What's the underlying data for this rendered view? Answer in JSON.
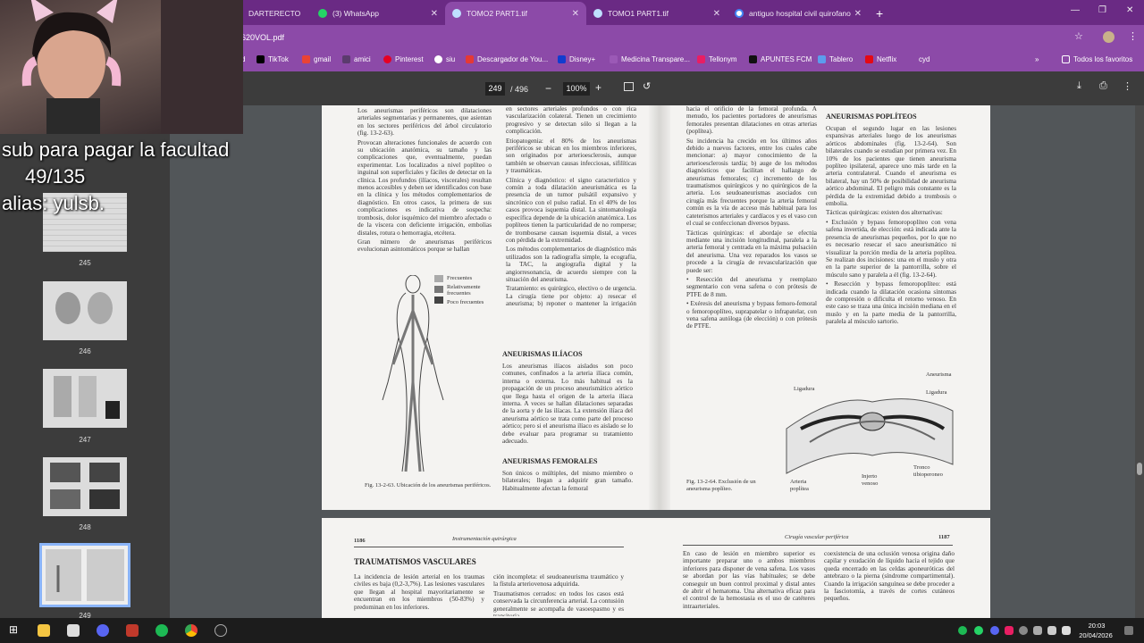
{
  "browser": {
    "tabs": [
      {
        "label": "DARTERECTO",
        "icon": "page-icon",
        "active": false
      },
      {
        "label": "(3) WhatsApp",
        "icon": "whatsapp-icon",
        "active": false
      },
      {
        "label": "TOMO2 PART1.tif",
        "icon": "page-icon",
        "active": true
      },
      {
        "label": "TOMO1 PART1.tif",
        "icon": "page-icon",
        "active": false
      },
      {
        "label": "antiguo hospital civil quirofano",
        "icon": "google-icon",
        "active": false
      }
    ],
    "new_tab": "+",
    "url": "620VOL.pdf",
    "bookmarks": [
      "d",
      "TikTok",
      "gmail",
      "amici",
      "Pinterest",
      "siu",
      "Descargador de You...",
      "Disney+",
      "Medicina Transpare...",
      "Tellonym",
      "APUNTES FCM",
      "Tablero",
      "Netflix",
      "cyd"
    ],
    "all_bookmarks": "Todos los favoritos"
  },
  "pdf": {
    "current_page": "249",
    "total_pages": "/ 496",
    "zoom": "100%",
    "thumbnails": [
      "245",
      "246",
      "247",
      "248",
      "249"
    ]
  },
  "overlay": {
    "line1": "sub para pagar la facultad",
    "line2": "49/135",
    "line3": "alias: yulsb."
  },
  "page_left": {
    "col1": [
      "Los aneurismas periféricos son dilataciones arteriales segmentarias y permanentes, que asientan en los sectores periféricos del árbol circulatorio (fig. 13-2-63).",
      "Provocan alteraciones funcionales de acuerdo con su ubicación anatómica, su tamaño y las complicaciones que, eventualmente, puedan experimentar. Los localizados a nivel poplíteo o inguinal son superficiales y fáciles de detectar en la clínica. Los profundos (ilíacos, viscerales) resultan menos accesibles y deben ser identificados con base en la clínica y los métodos complementarios de diagnóstico. En otros casos, la primera de sus complicaciones es indicativa de sospecha: trombosis, dolor isquémico del miembro afectado o de la víscera con deficiente irrigación, embolias distales, rotura o hemorragia, etcétera.",
      "Gran número de aneurismas periféricos evolucionan asintomáticos porque se hallan"
    ],
    "col2": [
      "en sectores arteriales profundos o con rica vascularización colateral. Tienen un crecimiento progresivo y se detectan sólo si llegan a la complicación.",
      "Etiopatogenia: el 80% de los aneurismas periféricos se ubican en los miembros inferiores, son originados por arterioesclerosis, aunque también se observan causas infecciosas, sifilíticas y traumáticas.",
      "Clínica y diagnóstico: el signo característico y común a toda dilatación aneurismática es la presencia de un tumor pulsátil expansivo y sincrónico con el pulso radial. En el 40% de los casos provoca isquemia distal. La sintomatología específica depende de la ubicación anatómica. Los poplíteos tienen la particularidad de no romperse; de trombosarse causan isquemia distal, a veces con pérdida de la extremidad.",
      "Los métodos complementarios de diagnóstico más utilizados son la radiografía simple, la ecografía, la TAC, la angiografía digital y la angiorresonancia, de acuerdo siempre con la situación del aneurisma.",
      "Tratamiento: es quirúrgico, electivo o de urgencia. La cirugía tiene por objeto: a) resecar el aneurisma; b) reponer o mantener la irrigación arterial; c) resolver las complicaciones isquémicas distales."
    ],
    "heading_iliacos": "ANEURISMAS ILÍACOS",
    "col2b": [
      "Los aneurismas ilíacos aislados son poco comunes, confinados a la arteria ilíaca común, interna o externa. Lo más habitual es la propagación de un proceso aneurismático aórtico que llega hasta el origen de la arteria ilíaca interna. A veces se hallan dilataciones separadas de la aorta y de las ilíacas. La extensión ilíaca del aneurisma aórtico se trata como parte del proceso aórtico; pero si el aneurisma ilíaco es aislado se lo debe evaluar para programar su tratamiento adecuado."
    ],
    "heading_femorales": "ANEURISMAS FEMORALES",
    "col2c": [
      "Son únicos o múltiples, del mismo miembro o bilaterales; llegan a adquirir gran tamaño. Habitualmente afectan la femoral"
    ],
    "legend": [
      "Frecuentes",
      "Relativamente frecuentes",
      "Poco frecuentes"
    ],
    "figure_caption": "Fig. 13-2-63. Ubicación de los aneurismas periféricos."
  },
  "page_right": {
    "col1": [
      "hacia el orificio de la femoral profunda. A menudo, los pacientes portadores de aneurismas femorales presentan dilataciones en otras arterias (poplítea).",
      "Su incidencia ha crecido en los últimos años debido a nuevos factores, entre los cuales cabe mencionar: a) mayor conocimiento de la arterioesclerosis tardía; b) auge de los métodos diagnósticos que facilitan el hallazgo de aneurismas femorales; c) incremento de los traumatismos quirúrgicos y no quirúrgicos de la arteria. Los seudoaneurismas asociados con cirugía más frecuentes porque la arteria femoral común es la vía de acceso más habitual para los cateterismos arteriales y cardíacos y es el vaso con el cual se confeccionan diversos bypass.",
      "Tácticas quirúrgicas: el abordaje se efectúa mediante una incisión longitudinal, paralela a la arteria femoral y centrada en la máxima pulsación del aneurisma. Una vez reparados los vasos se procede a la cirugía de revascularización que puede ser:",
      "• Resección del aneurisma y reemplazo segmentario con vena safena o con prótesis de PTFE de 8 mm.",
      "• Exéresis del aneurisma y bypass femoro-femoral o femoropoplíteo, suprapatelar o infrapatelar, con vena safena autóloga (de elección) o con prótesis de PTFE."
    ],
    "heading_popliteos": "ANEURISMAS POPLÍTEOS",
    "col2": [
      "Ocupan el segundo lugar en las lesiones expansivas arteriales luego de los aneurismas aórticos abdominales (fig. 13-2-64). Son bilaterales cuando se estudian por primera vez. En 10% de los pacientes que tienen aneurisma poplíteo ipsilateral, aparece uno más tarde en la arteria contralateral. Cuando el aneurisma es bilateral, hay un 50% de posibilidad de aneurisma aórtico abdominal. El peligro más constante es la pérdida de la extremidad debido a trombosis o embolia.",
      "Tácticas quirúrgicas: existen dos alternativas:",
      "• Exclusión y bypass femoropoplíteo con vena safena invertida, de elección: está indicada ante la presencia de aneurismas pequeños, por lo que no es necesario resecar el saco aneurismático ni visualizar la porción media de la arteria poplítea. Se realizan dos incisiones: una en el muslo y otra en la parte superior de la pantorrilla, sobre el músculo sano y paralela a él (fig. 13-2-64).",
      "• Resección y bypass femoropoplíteo: está indicada cuando la dilatación ocasiona síntomas de compresión o dificulta el retorno venoso. En este caso se traza una única incisión mediana en el muslo y en la parte media de la pantorrilla, paralela al músculo sartorio."
    ],
    "figure_labels": [
      "Aneurisma",
      "Ligadura",
      "Ligadura",
      "Tronco tibioperoneo",
      "Injerto venoso",
      "Arteria poplítea"
    ],
    "figure_caption": "Fig. 13-2-64. Exclusión de un aneurisma poplíteo."
  },
  "page_bottom": {
    "left_number": "1186",
    "left_header": "Instrumentación quirúrgica",
    "heading": "TRAUMATISMOS VASCULARES",
    "left_text": [
      "La incidencia de lesión arterial en los traumas civiles es baja (0,2-3,7%). Las lesiones vasculares que llegan al hospital mayoritariamente se encuentran en los miembros (50-83%) y predominan en los inferiores."
    ],
    "left_text2": [
      "ción incompleta: el seudoaneurisma traumático y la fístula arteriovenosa adquirida.",
      "Traumatismos cerrados: en todos los casos está conservada la circunferencia arterial. La contusión generalmente se acompaña de vasoespasmo y es transitoria."
    ],
    "right_header": "Cirugía vascular periférica",
    "right_number": "1187",
    "right_text": [
      "En caso de lesión en miembro superior es importante preparar uno o ambos miembros inferiores para disponer de vena safena. Los vasos se abordan por las vías habituales; se debe conseguir un buen control proximal y distal antes de abrir el hematoma. Una alternativa eficaz para el control de la hemostasia es el uso de catéteres intraarteriales."
    ],
    "right_text2": [
      "coexistencia de una oclusión venosa origina daño capilar y exudación de líquido hacia el tejido que queda encerrado en las celdas aponeuróticas del antebrazo o la pierna (síndrome compartimental). Cuando la irrigación sanguínea se debe proceder a la fasciotomía, a través de cortes cutáneos pequeños."
    ]
  },
  "taskbar": {
    "time": "20:03",
    "date": "20/04/2026"
  },
  "colors": {
    "tabbar": "#6a2a84",
    "addressbar": "#8c4aa8",
    "pdf_toolbar": "#3c3c3c",
    "viewer_bg": "#525659"
  }
}
